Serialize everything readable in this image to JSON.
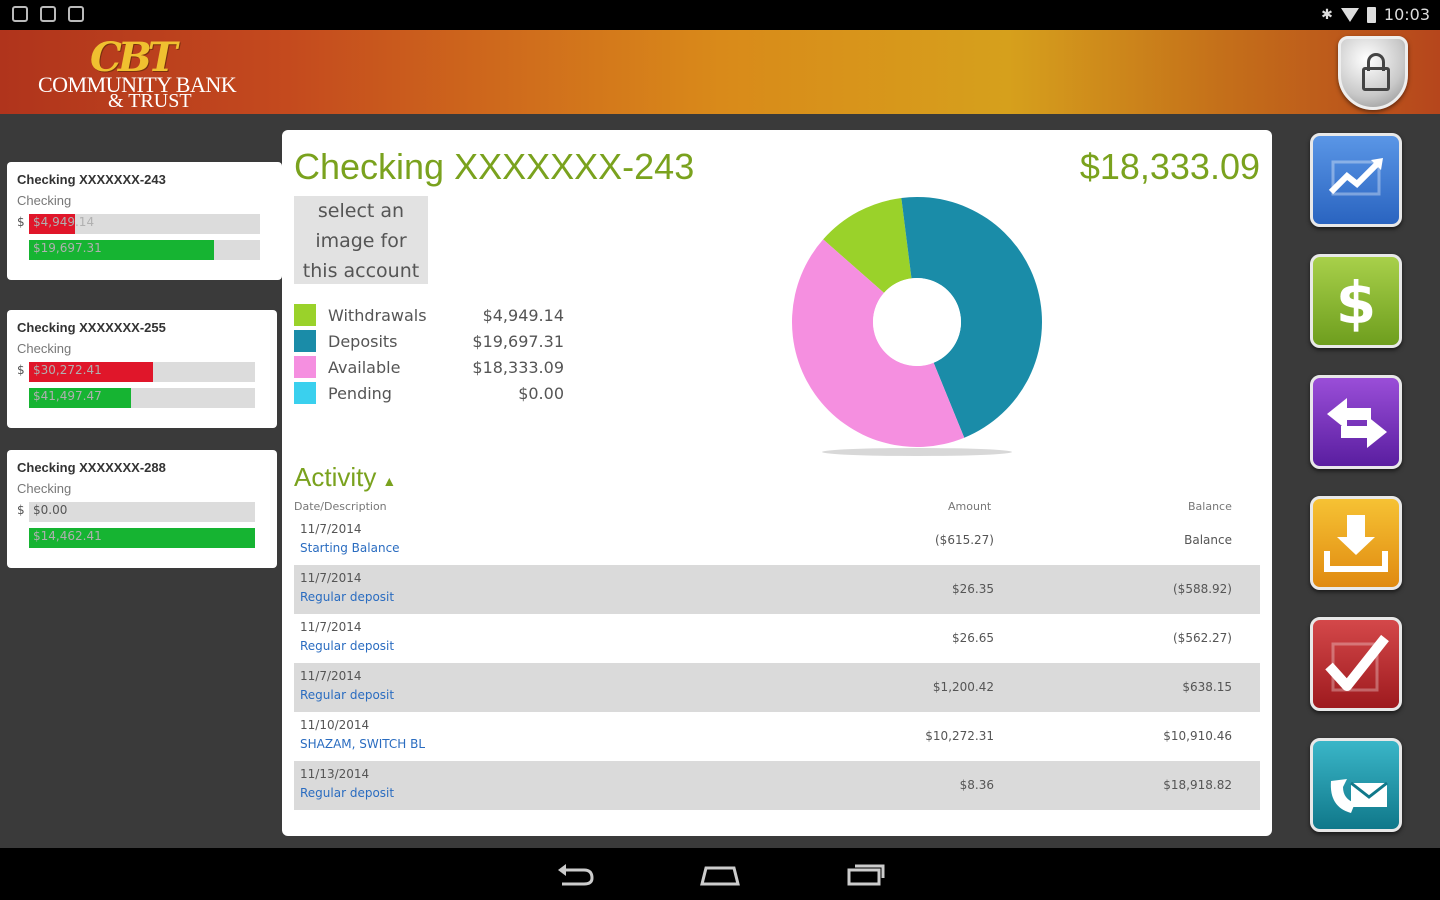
{
  "status_bar": {
    "time": "10:03"
  },
  "header": {
    "logo_mark": "CBT",
    "logo_line1": "COMMUNITY BANK",
    "logo_line2": "& TRUST"
  },
  "accounts": [
    {
      "name": "Checking XXXXXXX-243",
      "type": "Checking",
      "withdrawals_label": "$4,949.14",
      "deposits_label": "$19,697.31",
      "withdrawals_fill": 0.2,
      "deposits_fill": 0.8
    },
    {
      "name": "Checking XXXXXXX-255",
      "type": "Checking",
      "withdrawals_label": "$30,272.41",
      "deposits_label": "$41,497.47",
      "withdrawals_fill": 0.55,
      "deposits_fill": 0.45
    },
    {
      "name": "Checking XXXXXXX-288",
      "type": "Checking",
      "withdrawals_label": "$0.00",
      "deposits_label": "$14,462.41",
      "withdrawals_fill": 0.0,
      "deposits_fill": 1.0
    }
  ],
  "detail": {
    "title": "Checking XXXXXXX-243",
    "balance": "$18,333.09",
    "select_image": [
      "select an",
      "image for",
      "this account"
    ],
    "legend": [
      {
        "label": "Withdrawals",
        "value": "$4,949.14",
        "color": "#9ad22a"
      },
      {
        "label": "Deposits",
        "value": "$19,697.31",
        "color": "#1a8ca8"
      },
      {
        "label": "Available",
        "value": "$18,333.09",
        "color": "#f58fe0"
      },
      {
        "label": "Pending",
        "value": "$0.00",
        "color": "#3ad0ee"
      }
    ]
  },
  "chart_data": {
    "type": "pie",
    "categories": [
      "Withdrawals",
      "Deposits",
      "Available",
      "Pending"
    ],
    "values": [
      4949.14,
      19697.31,
      18333.09,
      0.0
    ]
  },
  "activity": {
    "title": "Activity",
    "col_date": "Date/Description",
    "col_amount": "Amount",
    "col_balance": "Balance",
    "rows": [
      {
        "date": "11/7/2014",
        "desc": "Starting Balance",
        "amount": "($615.27)",
        "balance": "Balance"
      },
      {
        "date": "11/7/2014",
        "desc": "Regular deposit",
        "amount": "$26.35",
        "balance": "($588.92)"
      },
      {
        "date": "11/7/2014",
        "desc": "Regular deposit",
        "amount": "$26.65",
        "balance": "($562.27)"
      },
      {
        "date": "11/7/2014",
        "desc": "Regular deposit",
        "amount": "$1,200.42",
        "balance": "$638.15"
      },
      {
        "date": "11/10/2014",
        "desc": "SHAZAM, SWITCH BL",
        "amount": "$10,272.31",
        "balance": "$10,910.46"
      },
      {
        "date": "11/13/2014",
        "desc": "Regular deposit",
        "amount": "$8.36",
        "balance": "$18,918.82"
      }
    ]
  },
  "tiles": [
    {
      "name": "accounts",
      "icon": "bank-chart-icon"
    },
    {
      "name": "pay-bills",
      "icon": "dollar-icon"
    },
    {
      "name": "transfers",
      "icon": "transfer-arrows-icon"
    },
    {
      "name": "deposit",
      "icon": "download-tray-icon"
    },
    {
      "name": "checks",
      "icon": "checkmark-icon"
    },
    {
      "name": "contact",
      "icon": "phone-mail-icon"
    }
  ]
}
